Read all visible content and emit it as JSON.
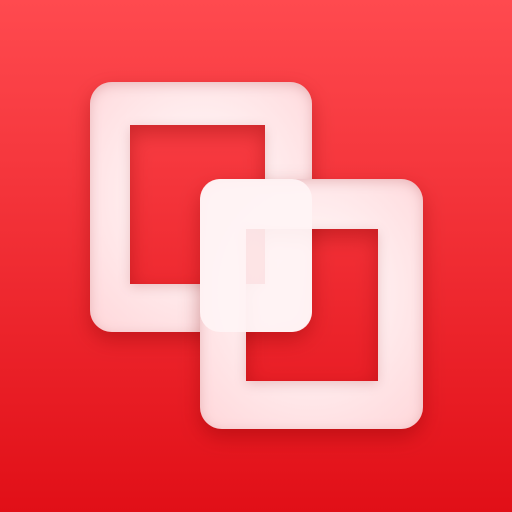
{
  "icon": {
    "name": "overlapping-squares-icon",
    "background_top": "#ff4a4f",
    "background_bottom": "#e10f17",
    "shape_color": "#fff1f2",
    "shadow_color": "#7a0006"
  }
}
